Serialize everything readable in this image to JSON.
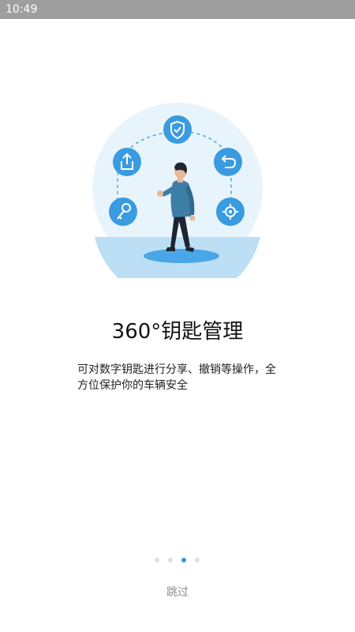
{
  "status_bar": {
    "time": "10:49"
  },
  "onboarding": {
    "title": "360°钥匙管理",
    "description_line1": "可对数字钥匙进行分享、撤销等操作，全",
    "description_line2": "方位保护你的车辆安全",
    "pager": {
      "total": 4,
      "active_index": 2
    },
    "skip_label": "跳过"
  },
  "illustration": {
    "icons": [
      "share-icon",
      "shield-check-icon",
      "undo-icon",
      "key-icon",
      "gear-icon"
    ],
    "colors": {
      "circle_bg": "#e8f4fc",
      "icon_bg": "#3a9be0",
      "floor": "#bcdff5"
    }
  }
}
